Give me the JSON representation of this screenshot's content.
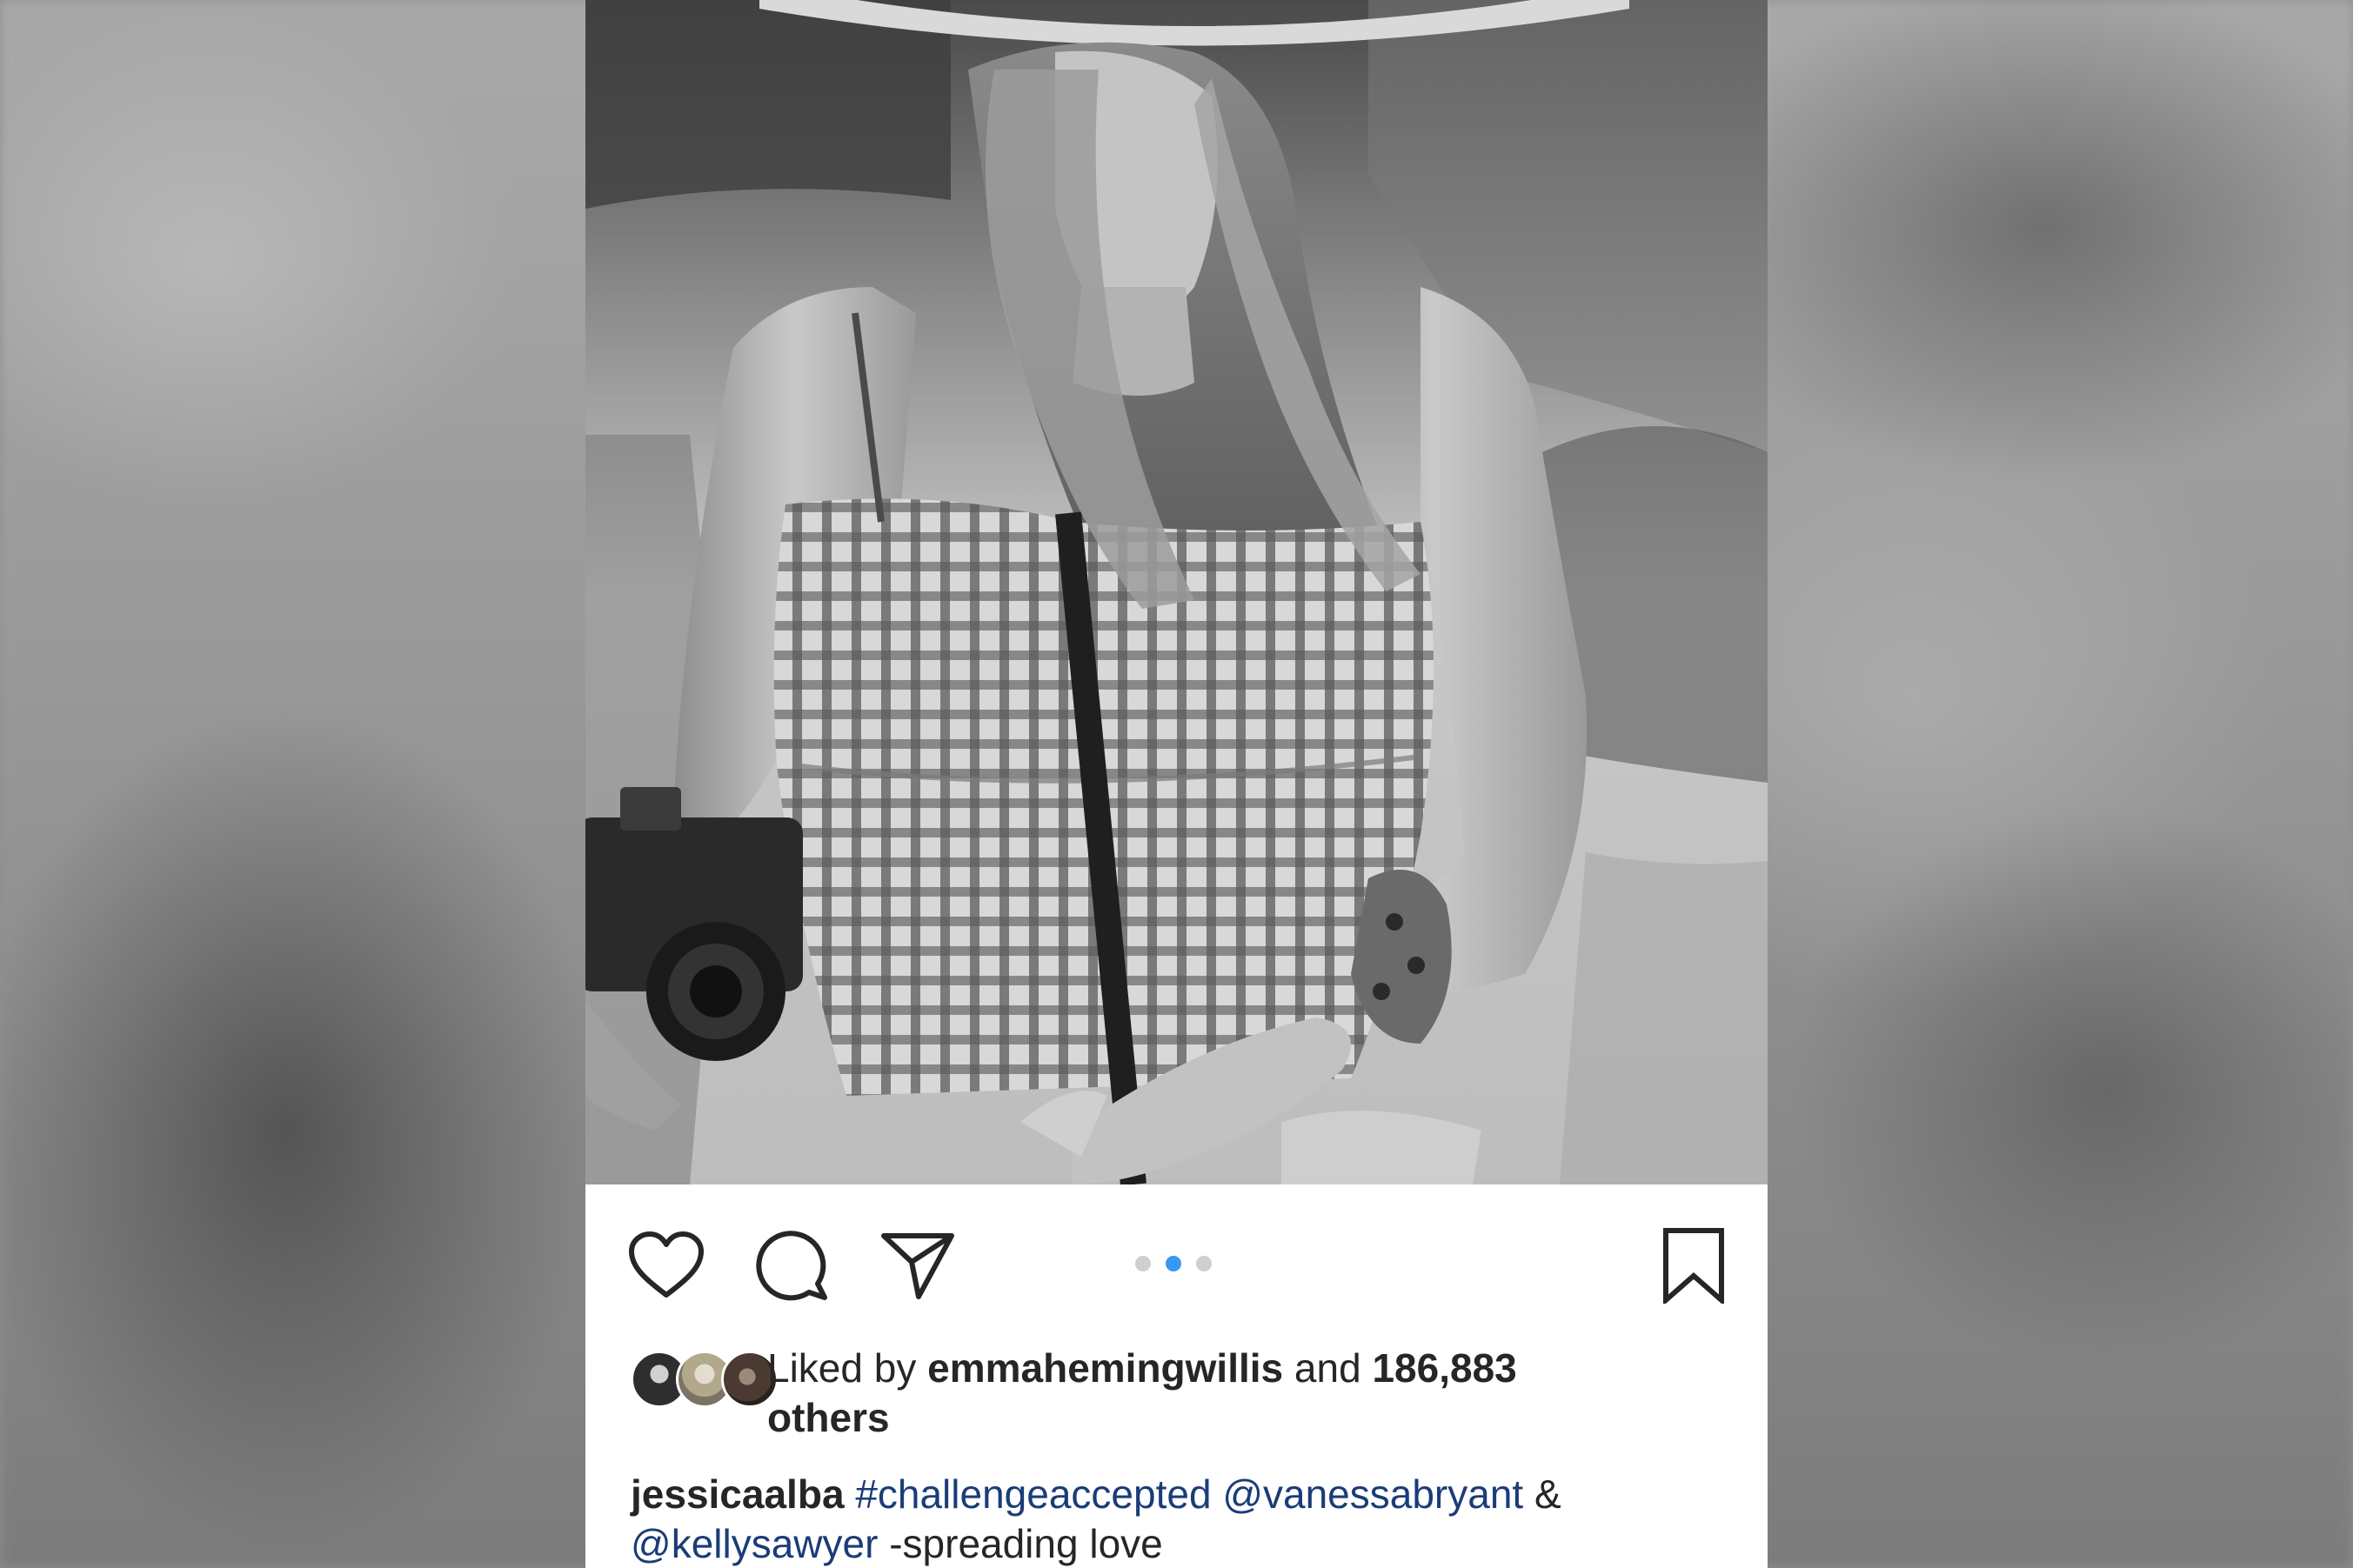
{
  "post": {
    "likes": {
      "prefix": "Liked by ",
      "liker": "emmahemingwillis",
      "joiner": " and ",
      "count_line1": "186,883",
      "count_line2": "others"
    },
    "caption": {
      "username": "jessicaalba",
      "hashtag": "#challengeaccepted",
      "mention1": "@vanessabryant",
      "ampersand": " &",
      "mention2": "@kellysawyer",
      "text": " -spreading love"
    },
    "carousel": {
      "count": 3,
      "active_index": 1
    },
    "icons": {
      "like": "heart-icon",
      "comment": "comment-bubble-icon",
      "share": "paper-plane-icon",
      "save": "bookmark-icon"
    },
    "colors": {
      "link": "#1b3c78",
      "active_dot": "#3897f0",
      "inactive_dot": "#cfcfcf",
      "text": "#262626"
    }
  }
}
